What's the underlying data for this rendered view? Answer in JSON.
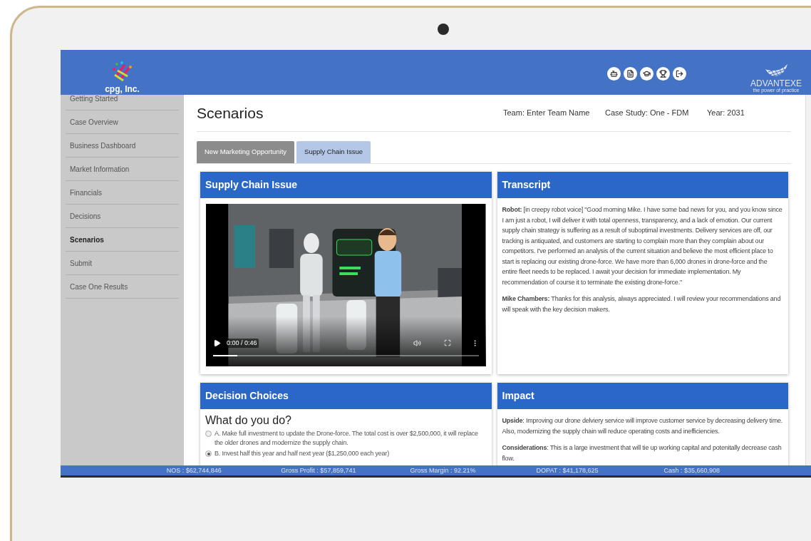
{
  "header": {
    "company": "cpg, Inc.",
    "brand": "ADVANTEXE",
    "tagline": "the power of practice"
  },
  "sidebar": {
    "items": [
      {
        "label": "Getting Started",
        "selected": false
      },
      {
        "label": "Case Overview",
        "selected": false
      },
      {
        "label": "Business Dashboard",
        "selected": false
      },
      {
        "label": "Market Information",
        "selected": false
      },
      {
        "label": "Financials",
        "selected": false
      },
      {
        "label": "Decisions",
        "selected": false
      },
      {
        "label": "Scenarios",
        "selected": true
      },
      {
        "label": "Submit",
        "selected": false
      },
      {
        "label": "Case One Results",
        "selected": false
      }
    ]
  },
  "page": {
    "title": "Scenarios",
    "team": "Team: Enter Team Name",
    "case_study": "Case Study: One - FDM",
    "year": "Year: 2031"
  },
  "tabs": [
    {
      "label": "New Marketing Opportunity",
      "selected": false
    },
    {
      "label": "Supply Chain Issue",
      "selected": true
    }
  ],
  "video_card": {
    "title": "Supply Chain Issue",
    "video": {
      "kind": "picture",
      "time": "0:00 / 0:46",
      "level": 0.09
    }
  },
  "transcript": {
    "title": "Transcript",
    "paragraphs": [
      "**Robot:** [in creepy robot voice] \"Good morning Mike. I have some bad news for you, and you know since I am just a robot, I will deliver it with total openness, transparency, and a lack of emotion. Our current supply chain strategy is suffering as a result of suboptimal investments. Delivery services are off, our tracking is antiquated, and customers are starting to complain more than they complain about our competitors. I've performed an analysis of the current situation and believe the most efficient place to start is replacing our existing drone-force. We have more than 6,000 drones in drone-force and the entire fleet needs to be replaced. I await your decision for immediate implementation. My recommendation of course it to terminate the existing drone-force.\"",
      "**Mike Chambers:** Thanks for this analysis, always appreciated. I will review your recommendations and will speak with the key decision makers."
    ]
  },
  "decision": {
    "title": "Decision Choices",
    "question": "What do you do?",
    "options": [
      {
        "label": "A. Make full investment to update the Drone-force. The total cost is over $2,500,000, it will replace the older drones and modernize the supply chain.",
        "selected": false
      },
      {
        "label": "B. Invest half this year and half next year ($1,250,000 each year)",
        "selected": true
      }
    ]
  },
  "impact": {
    "title": "Impact",
    "paragraphs": [
      "**Upside**: Improving our drone delviery service will improve customer service by decreasing delivery time. Also, modernizing the supply chain will reduce operating costs and inefficiencies.",
      "**Considerations**: This is a large investment that will tie up working capital and potenitally decrease cash flow."
    ]
  },
  "status_bar": [
    "NOS : $62,744,846",
    "Gross Profit : $57,859,741",
    "Gross Margin : 92.21%",
    "DOPAT : $41,178,625",
    "Cash : $35,660,908"
  ]
}
